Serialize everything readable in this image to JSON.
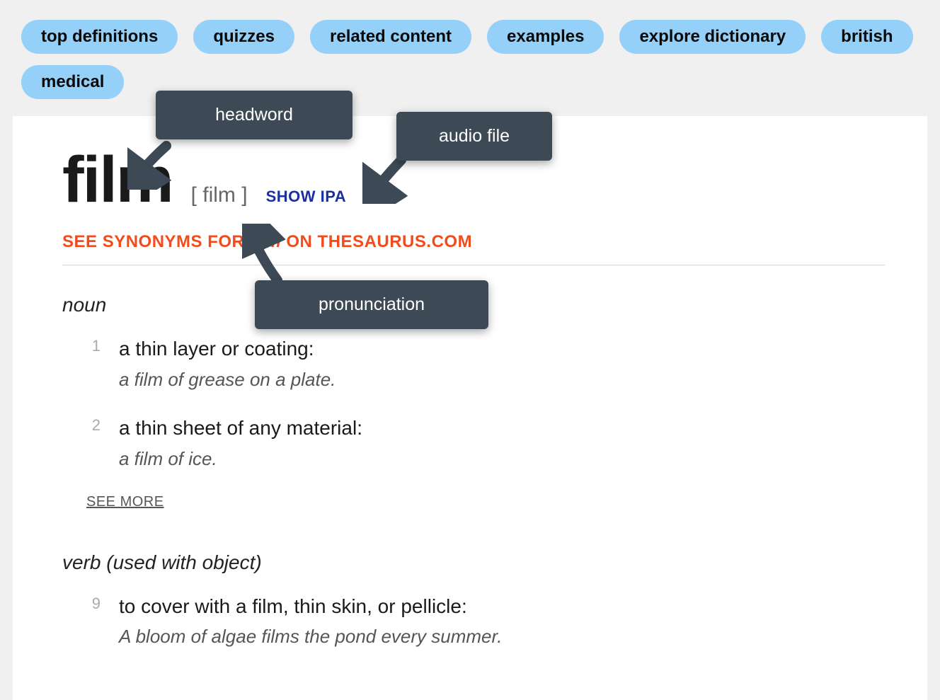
{
  "tabs": [
    "top definitions",
    "quizzes",
    "related content",
    "examples",
    "explore dictionary",
    "british",
    "medical"
  ],
  "entry": {
    "headword": "film",
    "pronunciation": "[ film ]",
    "show_ipa": "SHOW IPA",
    "synonyms_pre": "SEE SYNONYMS FOR ",
    "synonyms_word": "film",
    "synonyms_post": " ON THESAURUS.COM"
  },
  "noun": {
    "label": "noun",
    "defs": [
      {
        "n": "1",
        "text": "a thin layer or coating:",
        "example": "a film of grease on a plate."
      },
      {
        "n": "2",
        "text": "a thin sheet of any material:",
        "example": "a film of ice."
      }
    ],
    "see_more": "SEE MORE"
  },
  "verb": {
    "label": "verb (used with object)",
    "defs": [
      {
        "n": "9",
        "text": "to cover with a film, thin skin, or pellicle:",
        "example": "A bloom of algae films the pond every summer."
      }
    ]
  },
  "annotations": {
    "headword": "headword",
    "audio": "audio file",
    "pron": "pronunciation"
  }
}
